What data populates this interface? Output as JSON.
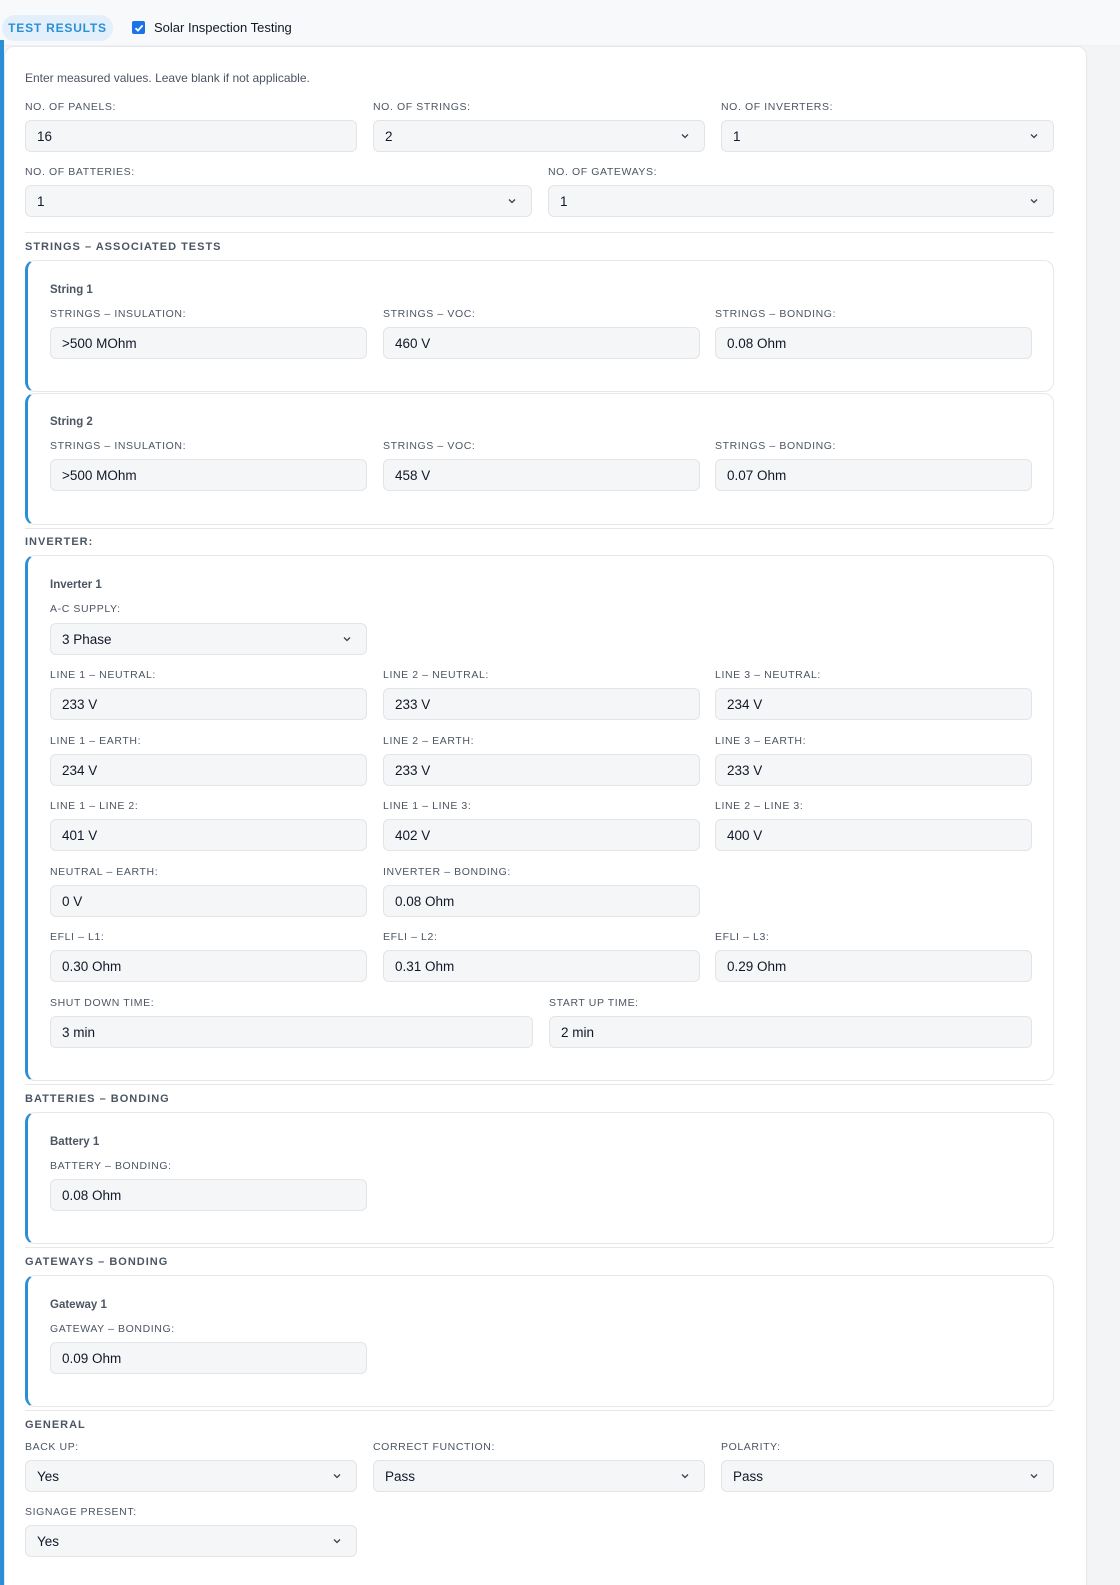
{
  "header": {
    "tag": "TEST RESULTS",
    "checkbox_label": "Solar Inspection Testing",
    "checked": true
  },
  "intro": "Enter measured values. Leave blank if not applicable.",
  "counts": {
    "panels": {
      "label": "NO. OF PANELS:",
      "value": "16"
    },
    "strings": {
      "label": "NO. OF STRINGS:",
      "value": "2"
    },
    "inverters": {
      "label": "NO. OF INVERTERS:",
      "value": "1"
    },
    "batteries": {
      "label": "NO. OF BATTERIES:",
      "value": "1"
    },
    "gateways": {
      "label": "NO. OF GATEWAYS:",
      "value": "1"
    }
  },
  "strings_section": {
    "title": "STRINGS – ASSOCIATED TESTS",
    "items": [
      {
        "name": "String 1",
        "insulation_label": "STRINGS – INSULATION:",
        "insulation": ">500 MOhm",
        "voc_label": "STRINGS – VOC:",
        "voc": "460 V",
        "bonding_label": "STRINGS – BONDING:",
        "bonding": "0.08 Ohm"
      },
      {
        "name": "String 2",
        "insulation_label": "STRINGS – INSULATION:",
        "insulation": ">500 MOhm",
        "voc_label": "STRINGS – VOC:",
        "voc": "458 V",
        "bonding_label": "STRINGS – BONDING:",
        "bonding": "0.07 Ohm"
      }
    ]
  },
  "inverter_section": {
    "title": "INVERTER:",
    "name": "Inverter 1",
    "ac_supply_label": "A-C SUPPLY:",
    "ac_supply": "3 Phase",
    "l1n_label": "LINE 1 – NEUTRAL:",
    "l1n": "233 V",
    "l2n_label": "LINE 2 – NEUTRAL:",
    "l2n": "233 V",
    "l3n_label": "LINE 3 – NEUTRAL:",
    "l3n": "234 V",
    "l1e_label": "LINE 1 – EARTH:",
    "l1e": "234 V",
    "l2e_label": "LINE 2 – EARTH:",
    "l2e": "233 V",
    "l3e_label": "LINE 3 – EARTH:",
    "l3e": "233 V",
    "l1l2_label": "LINE 1 – LINE 2:",
    "l1l2": "401 V",
    "l1l3_label": "LINE 1 – LINE 3:",
    "l1l3": "402 V",
    "l2l3_label": "LINE 2 – LINE 3:",
    "l2l3": "400 V",
    "ne_label": "NEUTRAL – EARTH:",
    "ne": "0 V",
    "bonding_label": "INVERTER – BONDING:",
    "bonding": "0.08 Ohm",
    "efli1_label": "EFLI – L1:",
    "efli1": "0.30 Ohm",
    "efli2_label": "EFLI – L2:",
    "efli2": "0.31 Ohm",
    "efli3_label": "EFLI – L3:",
    "efli3": "0.29 Ohm",
    "shutdown_label": "SHUT DOWN TIME:",
    "shutdown": "3 min",
    "startup_label": "START UP TIME:",
    "startup": "2 min"
  },
  "battery_section": {
    "title": "BATTERIES – BONDING",
    "name": "Battery 1",
    "bonding_label": "BATTERY – BONDING:",
    "bonding": "0.08 Ohm"
  },
  "gateway_section": {
    "title": "GATEWAYS – BONDING",
    "name": "Gateway 1",
    "bonding_label": "GATEWAY – BONDING:",
    "bonding": "0.09 Ohm"
  },
  "general": {
    "title": "GENERAL",
    "backup_label": "BACK UP:",
    "backup": "Yes",
    "function_label": "CORRECT FUNCTION:",
    "function": "Pass",
    "polarity_label": "POLARITY:",
    "polarity": "Pass",
    "signage_label": "SIGNAGE PRESENT:",
    "signage": "Yes"
  }
}
